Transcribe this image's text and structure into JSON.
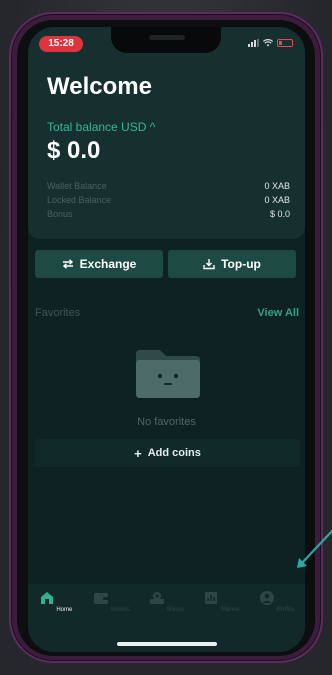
{
  "status_bar": {
    "time": "15:28"
  },
  "header": {
    "title": "Welcome",
    "total_label": "Total balance USD ^",
    "total_value": "$ 0.0",
    "balances": [
      {
        "label": "Wallet Balance",
        "value": "0 XAB"
      },
      {
        "label": "Locked Balance",
        "value": "0 XAB"
      },
      {
        "label": "Bonus",
        "value": "$ 0.0"
      }
    ]
  },
  "actions": {
    "exchange_label": "Exchange",
    "topup_label": "Top-up"
  },
  "favorites": {
    "label": "Favorites",
    "view_all": "View All",
    "empty_text": "No favorites",
    "add_label": "Add coins"
  },
  "tabbar": {
    "tabs": [
      {
        "label": "Home",
        "icon": "home-icon",
        "active": true
      },
      {
        "label": "Wallets",
        "icon": "wallet-icon",
        "active": false
      },
      {
        "label": "Bonus",
        "icon": "bonus-icon",
        "active": false
      },
      {
        "label": "Market",
        "icon": "chart-icon",
        "active": false
      },
      {
        "label": "Profile",
        "icon": "user-icon",
        "active": false
      }
    ]
  },
  "colors": {
    "accent": "#33b89a",
    "button": "#1d4a42",
    "background": "#0f2223",
    "time_pill": "#e0343d"
  }
}
